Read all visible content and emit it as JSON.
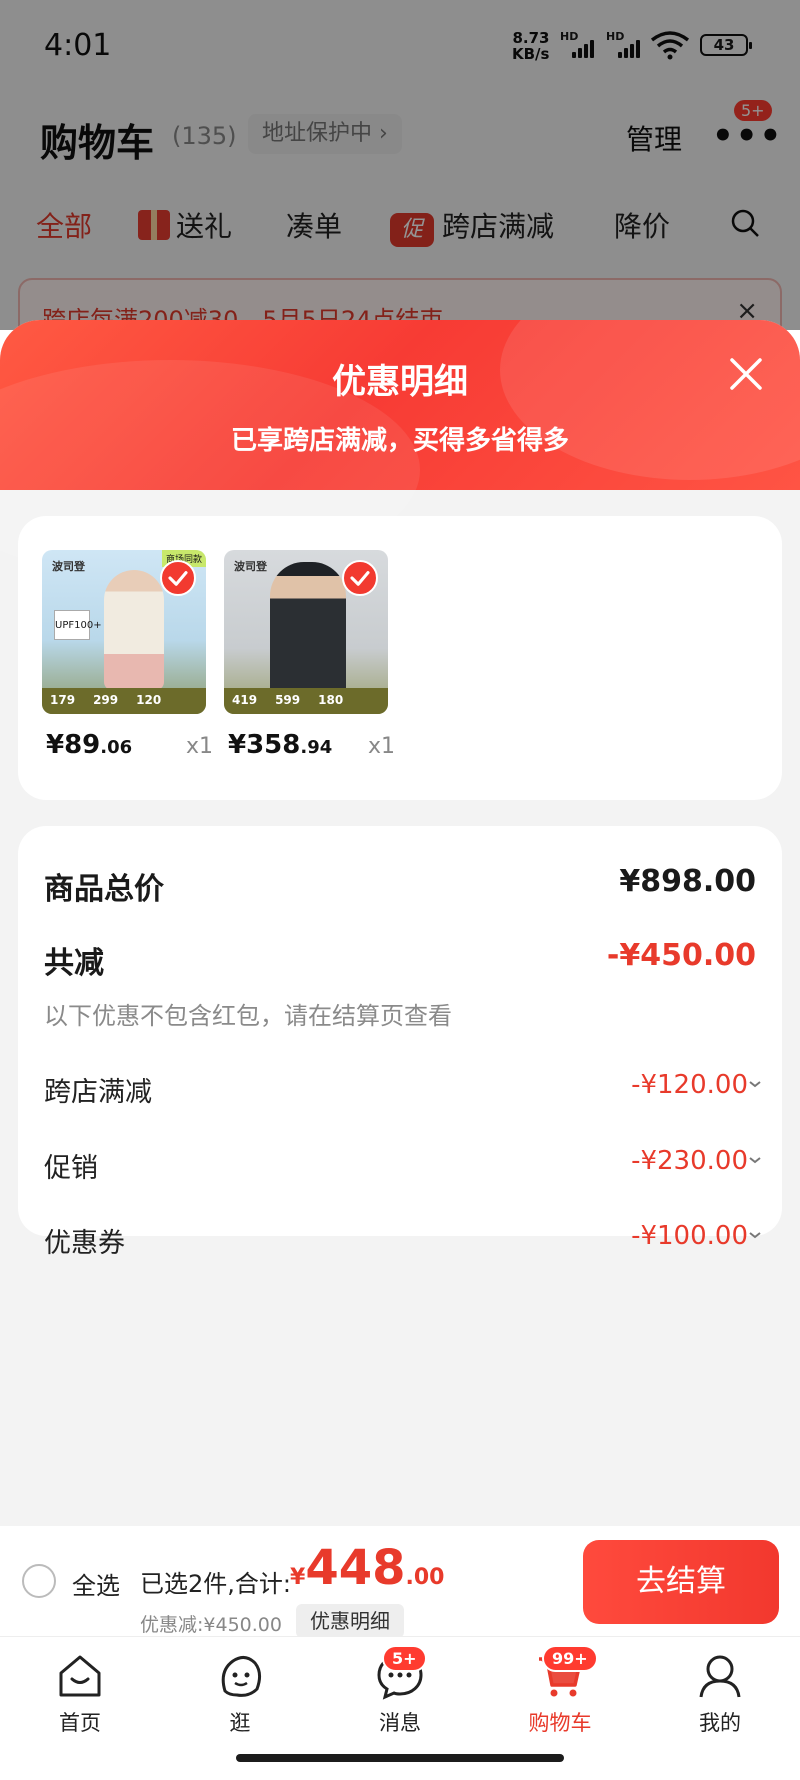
{
  "status_bar": {
    "time": "4:01",
    "net_speed_value": "8.73",
    "net_speed_unit": "KB/s",
    "hd1": "HD",
    "hd2": "HD",
    "battery": "43"
  },
  "cart_header": {
    "title": "购物车",
    "count": "(135)",
    "address": "地址保护中 ›",
    "manage": "管理",
    "more_badge": "5+",
    "more": "•••"
  },
  "cart_tabs": [
    "全部",
    "送礼",
    "凑单",
    "跨店满减",
    "降价"
  ],
  "cu_icon": "促",
  "promo_banner": {
    "text": "跨店每满200减30，5月5日24点结束",
    "close": "×"
  },
  "sheet": {
    "title": "优惠明细",
    "subtitle": "已享跨店满减，买得多省得多"
  },
  "products": [
    {
      "brand": "波司登",
      "badge": "商场同款",
      "tag": "UPF100+",
      "strip": [
        "179",
        "299",
        "120"
      ],
      "price_int": "¥89",
      "price_dec": ".06",
      "qty": "x1"
    },
    {
      "brand": "波司登",
      "strip": [
        "419",
        "599",
        "180"
      ],
      "price_int": "¥358",
      "price_dec": ".94",
      "qty": "x1"
    }
  ],
  "summary": {
    "total_label": "商品总价",
    "total_value": "¥898.00",
    "reduce_label": "共减",
    "reduce_value": "-¥450.00",
    "note": "以下优惠不包含红包，请在结算页查看",
    "items": [
      {
        "label": "跨店满减",
        "value": "-¥120.00"
      },
      {
        "label": "促销",
        "value": "-¥230.00"
      },
      {
        "label": "优惠券",
        "value": "-¥100.00"
      }
    ]
  },
  "checkout": {
    "select_all": "全选",
    "selected_text": "已选2件,合计:",
    "total_currency": "¥",
    "total_int": "448",
    "total_dec": ".00",
    "discount_text": "优惠减:¥450.00",
    "detail_label": "优惠明细",
    "button_label": "去结算"
  },
  "tab_bar": [
    {
      "label": "首页",
      "icon": "home-icon"
    },
    {
      "label": "逛",
      "icon": "browse-icon"
    },
    {
      "label": "消息",
      "icon": "message-icon",
      "badge": "5+"
    },
    {
      "label": "购物车",
      "icon": "cart-icon",
      "badge": "99+",
      "active": true
    },
    {
      "label": "我的",
      "icon": "profile-icon"
    }
  ],
  "colors": {
    "accent": "#e83a2b",
    "sheet_header": "#f73b34",
    "background": "#f3f3f3"
  }
}
